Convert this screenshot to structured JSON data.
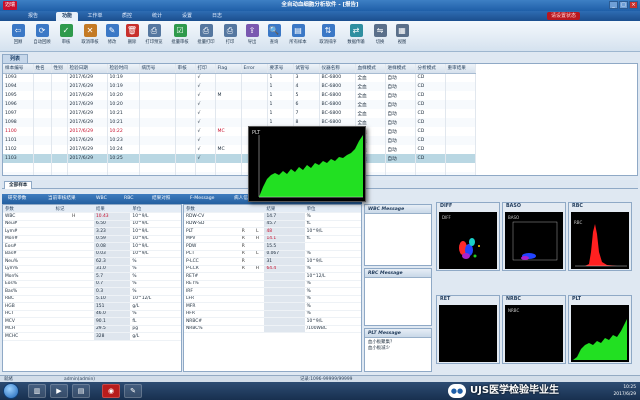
{
  "titlebar": {
    "logo": "迈瑞",
    "title": "全自动血细胞分析软件 - [报告]",
    "min": "_",
    "max": "□",
    "close": "×"
  },
  "menu": {
    "tabs": [
      "报告",
      "功能",
      "工作单",
      "质控",
      "统计",
      "设置",
      "日志"
    ],
    "active_index": 1,
    "alarm": "请设置状态"
  },
  "toolbar": {
    "items": [
      {
        "label": "回顾",
        "icon": "back-icon",
        "color": "#3b78c6",
        "glyph": "⇦"
      },
      {
        "label": "自动回顾",
        "icon": "auto-review-icon",
        "color": "#3b78c6",
        "glyph": "⟳"
      },
      {
        "label": "审核",
        "icon": "verify-icon",
        "color": "#2f9a4c",
        "glyph": "✓"
      },
      {
        "label": "取消审核",
        "icon": "unverify-icon",
        "color": "#c47a24",
        "glyph": "✕"
      },
      {
        "label": "修改",
        "icon": "edit-icon",
        "color": "#3b78c6",
        "glyph": "✎"
      },
      {
        "label": "删除",
        "icon": "delete-icon",
        "color": "#c8302c",
        "glyph": "🗑"
      },
      {
        "label": "打印预览",
        "icon": "print-preview-icon",
        "color": "#5577a0",
        "glyph": "⎙"
      },
      {
        "label": "批量审核",
        "icon": "batch-verify-icon",
        "color": "#2f9a4c",
        "glyph": "☑"
      },
      {
        "label": "批量打印",
        "icon": "batch-print-icon",
        "color": "#5577a0",
        "glyph": "⎙"
      },
      {
        "label": "打印",
        "icon": "print-icon",
        "color": "#5577a0",
        "glyph": "⎙"
      },
      {
        "label": "导出",
        "icon": "export-icon",
        "color": "#7a58b0",
        "glyph": "⇪"
      },
      {
        "label": "查询",
        "icon": "query-icon",
        "color": "#3b78c6",
        "glyph": "🔍"
      },
      {
        "label": "所有样本",
        "icon": "all-samples-icon",
        "color": "#3b78c6",
        "glyph": "▤"
      },
      {
        "label": "取消排序",
        "icon": "unsort-icon",
        "color": "#3b78c6",
        "glyph": "⇅"
      },
      {
        "label": "数据传输",
        "icon": "transfer-icon",
        "color": "#2f8fa0",
        "glyph": "⇄"
      },
      {
        "label": "切换",
        "icon": "switch-icon",
        "color": "#5a6f8a",
        "glyph": "⇋"
      },
      {
        "label": "视图",
        "icon": "view-icon",
        "color": "#5a6f8a",
        "glyph": "▦"
      }
    ]
  },
  "list": {
    "tab": "列表",
    "columns": [
      "样本编号",
      "姓名",
      "性别",
      "检验日期",
      "检验时间",
      "病历号",
      "审核",
      "打印",
      "Flag",
      "Error",
      "要求号",
      "试管号",
      "仪器名称",
      "血样模式",
      "进样模式",
      "分析模式",
      "重审结果"
    ],
    "rows": [
      [
        "1093",
        "",
        "",
        "2017/6/29",
        "10:19",
        "",
        "",
        "√",
        "",
        "",
        "1",
        "3",
        "BC-6800",
        "全血",
        "自动",
        "CD",
        ""
      ],
      [
        "1094",
        "",
        "",
        "2017/6/29",
        "10:19",
        "",
        "",
        "√",
        "",
        "",
        "1",
        "4",
        "BC-6800",
        "全血",
        "自动",
        "CD",
        ""
      ],
      [
        "1095",
        "",
        "",
        "2017/6/29",
        "10:20",
        "",
        "",
        "√",
        "M",
        "",
        "1",
        "5",
        "BC-6800",
        "全血",
        "自动",
        "CD",
        ""
      ],
      [
        "1096",
        "",
        "",
        "2017/6/29",
        "10:20",
        "",
        "",
        "√",
        "",
        "",
        "1",
        "6",
        "BC-6800",
        "全血",
        "自动",
        "CD",
        ""
      ],
      [
        "1097",
        "",
        "",
        "2017/6/29",
        "10:21",
        "",
        "",
        "√",
        "",
        "",
        "1",
        "7",
        "BC-6800",
        "全血",
        "自动",
        "CD",
        ""
      ],
      [
        "1098",
        "",
        "",
        "2017/6/29",
        "10:21",
        "",
        "",
        "√",
        "",
        "",
        "1",
        "8",
        "BC-6800",
        "全血",
        "自动",
        "CD",
        ""
      ],
      [
        "1100",
        "",
        "",
        "2017/6/29",
        "10:22",
        "",
        "",
        "√",
        "MC",
        "",
        "1",
        "10",
        "BC-6800",
        "全血",
        "自动",
        "CD",
        ""
      ],
      [
        "1101",
        "",
        "",
        "2017/6/29",
        "10:23",
        "",
        "",
        "√",
        "",
        "",
        "1",
        "1",
        "BC-6800",
        "全血",
        "自动",
        "CD",
        ""
      ],
      [
        "1102",
        "",
        "",
        "2017/6/29",
        "10:24",
        "",
        "",
        "√",
        "MC",
        "",
        "1",
        "2",
        "BC-6800",
        "全血",
        "自动",
        "CD",
        ""
      ],
      [
        "1103",
        "",
        "",
        "2017/6/29",
        "10:25",
        "",
        "",
        "√",
        "",
        "",
        "1",
        "3",
        "BC-6800",
        "全血",
        "自动",
        "CD",
        ""
      ]
    ],
    "selected_index": 9,
    "red_index": 6
  },
  "results_tab": "全部样本",
  "result_header": [
    "研究参数",
    "当前审核结果",
    "WBC",
    "RBC",
    "结果对照",
    "F-Message",
    "病人信息"
  ],
  "left_results": {
    "columns": [
      "参数",
      "标记",
      "结果",
      "单位"
    ],
    "rows": [
      [
        "WBC",
        "H",
        "10.43",
        "10^9/L",
        true
      ],
      [
        "Neu#",
        "",
        "6.50",
        "10^9/L",
        false
      ],
      [
        "Lym#",
        "",
        "3.23",
        "10^9/L",
        false
      ],
      [
        "Mon#",
        "",
        "0.59",
        "10^9/L",
        false
      ],
      [
        "Eos#",
        "",
        "0.08",
        "10^9/L",
        false
      ],
      [
        "Bas#",
        "",
        "0.03",
        "10^9/L",
        false
      ],
      [
        "Neu%",
        "",
        "62.3",
        "%",
        false
      ],
      [
        "Lym%",
        "",
        "31.0",
        "%",
        false
      ],
      [
        "Mon%",
        "",
        "5.7",
        "%",
        false
      ],
      [
        "Eos%",
        "",
        "0.7",
        "%",
        false
      ],
      [
        "Bas%",
        "",
        "0.3",
        "%",
        false
      ],
      [
        "RBC",
        "",
        "5.10",
        "10^12/L",
        false
      ],
      [
        "HGB",
        "",
        "151",
        "g/L",
        false
      ],
      [
        "HCT",
        "",
        "46.0",
        "%",
        false
      ],
      [
        "MCV",
        "",
        "90.1",
        "fL",
        false
      ],
      [
        "MCH",
        "",
        "29.5",
        "pg",
        false
      ],
      [
        "MCHC",
        "",
        "328",
        "g/L",
        false
      ]
    ]
  },
  "right_results": {
    "columns": [
      "参数",
      "",
      "",
      "结果",
      "单位"
    ],
    "rows": [
      [
        "RDW-CV",
        "",
        "",
        "14.7",
        "%",
        false
      ],
      [
        "RDW-SD",
        "",
        "",
        "45.7",
        "fL",
        false
      ],
      [
        "PLT",
        "R",
        "L",
        "48",
        "10^9/L",
        true
      ],
      [
        "MPV",
        "R",
        "H",
        "14.1",
        "fL",
        true
      ],
      [
        "PDW",
        "R",
        "",
        "15.5",
        "",
        false
      ],
      [
        "PCT",
        "R",
        "L",
        "0.067",
        "%",
        false
      ],
      [
        "P-LCC",
        "R",
        "",
        "31",
        "10^9/L",
        false
      ],
      [
        "P-LCR",
        "R",
        "H",
        "64.4",
        "%",
        true
      ],
      [
        "RET#",
        "",
        "",
        "",
        "10^12/L",
        false
      ],
      [
        "RET%",
        "",
        "",
        "",
        "%",
        false
      ],
      [
        "IRF",
        "",
        "",
        "",
        "%",
        false
      ],
      [
        "LFR",
        "",
        "",
        "",
        "%",
        false
      ],
      [
        "MFR",
        "",
        "",
        "",
        "%",
        false
      ],
      [
        "HFR",
        "",
        "",
        "",
        "%",
        false
      ],
      [
        "NRBC#",
        "",
        "",
        "",
        "10^9/L",
        false
      ],
      [
        "NRBC%",
        "",
        "",
        "",
        "/100WBC",
        false
      ]
    ]
  },
  "messages": {
    "wbc_title": "WBC Message",
    "rbc_title": "RBC Message",
    "plt_title": "PLT Message",
    "plt_lines": [
      "血小板聚集？",
      "血小板减少"
    ]
  },
  "plots": {
    "diff": "DIFF",
    "baso": "BASO",
    "rbc": "RBC",
    "ret": "RET",
    "nrbc": "NRBC",
    "plt": "PLT",
    "popup": "PLT",
    "diff_inner": "DIFF",
    "baso_inner": "BASO",
    "rbc_inner": "RBC",
    "nrbc_inner": "NRBC"
  },
  "status": {
    "left": "就绪",
    "user": "admin(admin)",
    "record": "记录:1096-99999/99999"
  },
  "watermark": "UJS医学检验毕业生",
  "clock": {
    "date": "2017/6/29",
    "time": "10:25"
  },
  "colors": {
    "accent": "#1f5fa8",
    "alert": "#c8102e",
    "plot_green": "#22e022",
    "selected_row": "#b9d7e3"
  }
}
